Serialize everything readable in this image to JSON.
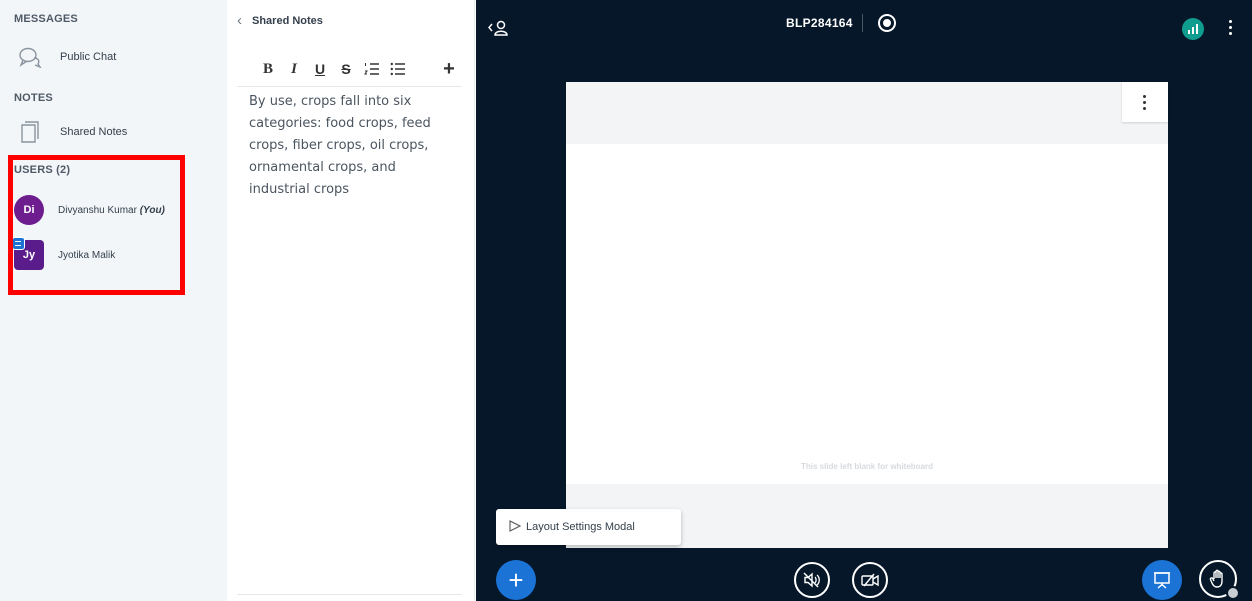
{
  "userlist": {
    "messages_title": "MESSAGES",
    "public_chat_label": "Public Chat",
    "notes_title": "NOTES",
    "shared_notes_label": "Shared Notes",
    "users_title": "USERS (2)",
    "users": [
      {
        "initials": "Di",
        "name": "Divyanshu Kumar",
        "suffix": "(You)"
      },
      {
        "initials": "Jy",
        "name": "Jyotika Malik",
        "suffix": ""
      }
    ]
  },
  "notes": {
    "header_title": "Shared Notes",
    "back_glyph": "‹",
    "toolbar": {
      "bold": "B",
      "italic": "I",
      "underline": "U",
      "strike": "S",
      "ordered_list": "≔",
      "bullet_list": "☰",
      "insert": "+"
    },
    "content": "By use, crops fall into six categories: food crops, feed crops, fiber crops, oil crops, ornamental crops, and industrial crops"
  },
  "main": {
    "meeting_title": "BLP284164",
    "slide_caption": "This slide left blank for whiteboard",
    "layout_modal_label": "Layout Settings Modal",
    "add_button_glyph": "+"
  },
  "colors": {
    "main_bg": "#06172a",
    "accent_blue": "#1b74d5",
    "connection_green": "#0f9d8f",
    "avatar_purple": "#6e1d8f",
    "highlight_red": "#ff0000"
  },
  "icons": [
    "chat-bubbles-icon",
    "document-icon",
    "user-list-toggle-icon",
    "record-icon",
    "connection-status-icon",
    "more-options-icon",
    "plus-icon",
    "audio-off-icon",
    "video-off-icon",
    "presentation-icon",
    "raise-hand-icon"
  ]
}
